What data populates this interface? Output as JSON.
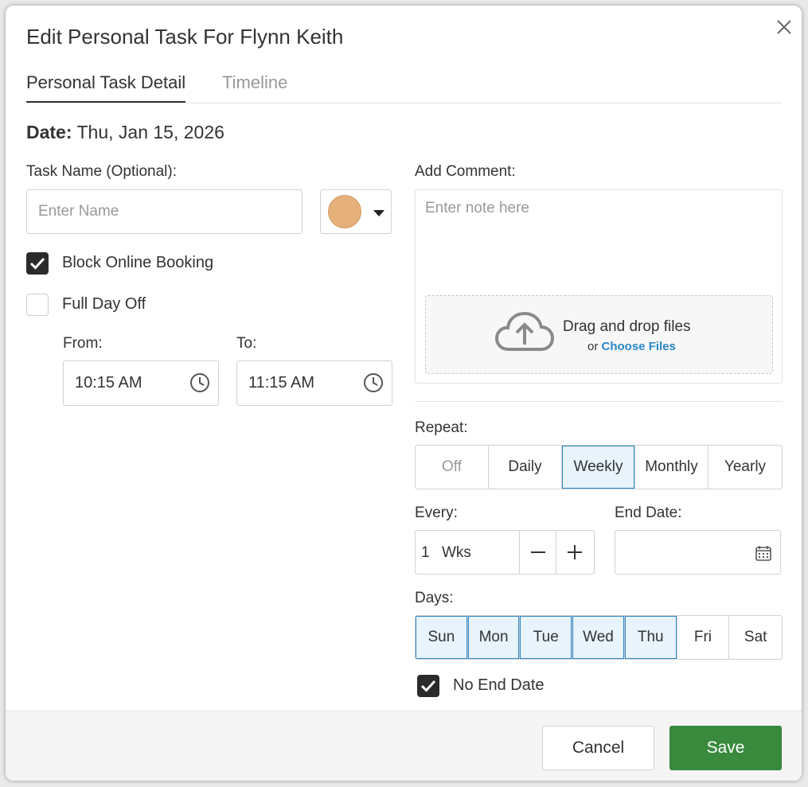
{
  "dialog": {
    "title": "Edit Personal Task For Flynn Keith",
    "tabs": [
      {
        "label": "Personal Task Detail",
        "active": true
      },
      {
        "label": "Timeline",
        "active": false
      }
    ]
  },
  "date": {
    "label": "Date:",
    "value": "Thu, Jan 15, 2026"
  },
  "task_name": {
    "label": "Task Name (Optional):",
    "placeholder": "Enter Name",
    "value": ""
  },
  "color": {
    "selected": "#e5b07a"
  },
  "options": {
    "block_online_booking": {
      "label": "Block Online Booking",
      "checked": true
    },
    "full_day_off": {
      "label": "Full Day Off",
      "checked": false
    }
  },
  "time": {
    "from_label": "From:",
    "from_value": "10:15 AM",
    "to_label": "To:",
    "to_value": "11:15 AM"
  },
  "comment": {
    "label": "Add Comment:",
    "placeholder": "Enter note here",
    "drop_title": "Drag and drop files",
    "drop_or": "or",
    "drop_link": "Choose Files"
  },
  "repeat": {
    "label": "Repeat:",
    "options": [
      "Off",
      "Daily",
      "Weekly",
      "Monthly",
      "Yearly"
    ],
    "selected": "Weekly"
  },
  "every": {
    "label": "Every:",
    "value": "1",
    "unit": "Wks"
  },
  "end_date": {
    "label": "End Date:",
    "value": ""
  },
  "days": {
    "label": "Days:",
    "options": [
      "Sun",
      "Mon",
      "Tue",
      "Wed",
      "Thu",
      "Fri",
      "Sat"
    ],
    "selected": [
      "Sun",
      "Mon",
      "Tue",
      "Wed",
      "Thu"
    ]
  },
  "no_end_date": {
    "label": "No End Date",
    "checked": true
  },
  "footer": {
    "cancel_label": "Cancel",
    "save_label": "Save"
  },
  "colors": {
    "accent": "#2a87c8",
    "save": "#3a8a3e",
    "selected_bg": "#e8f3fb"
  }
}
